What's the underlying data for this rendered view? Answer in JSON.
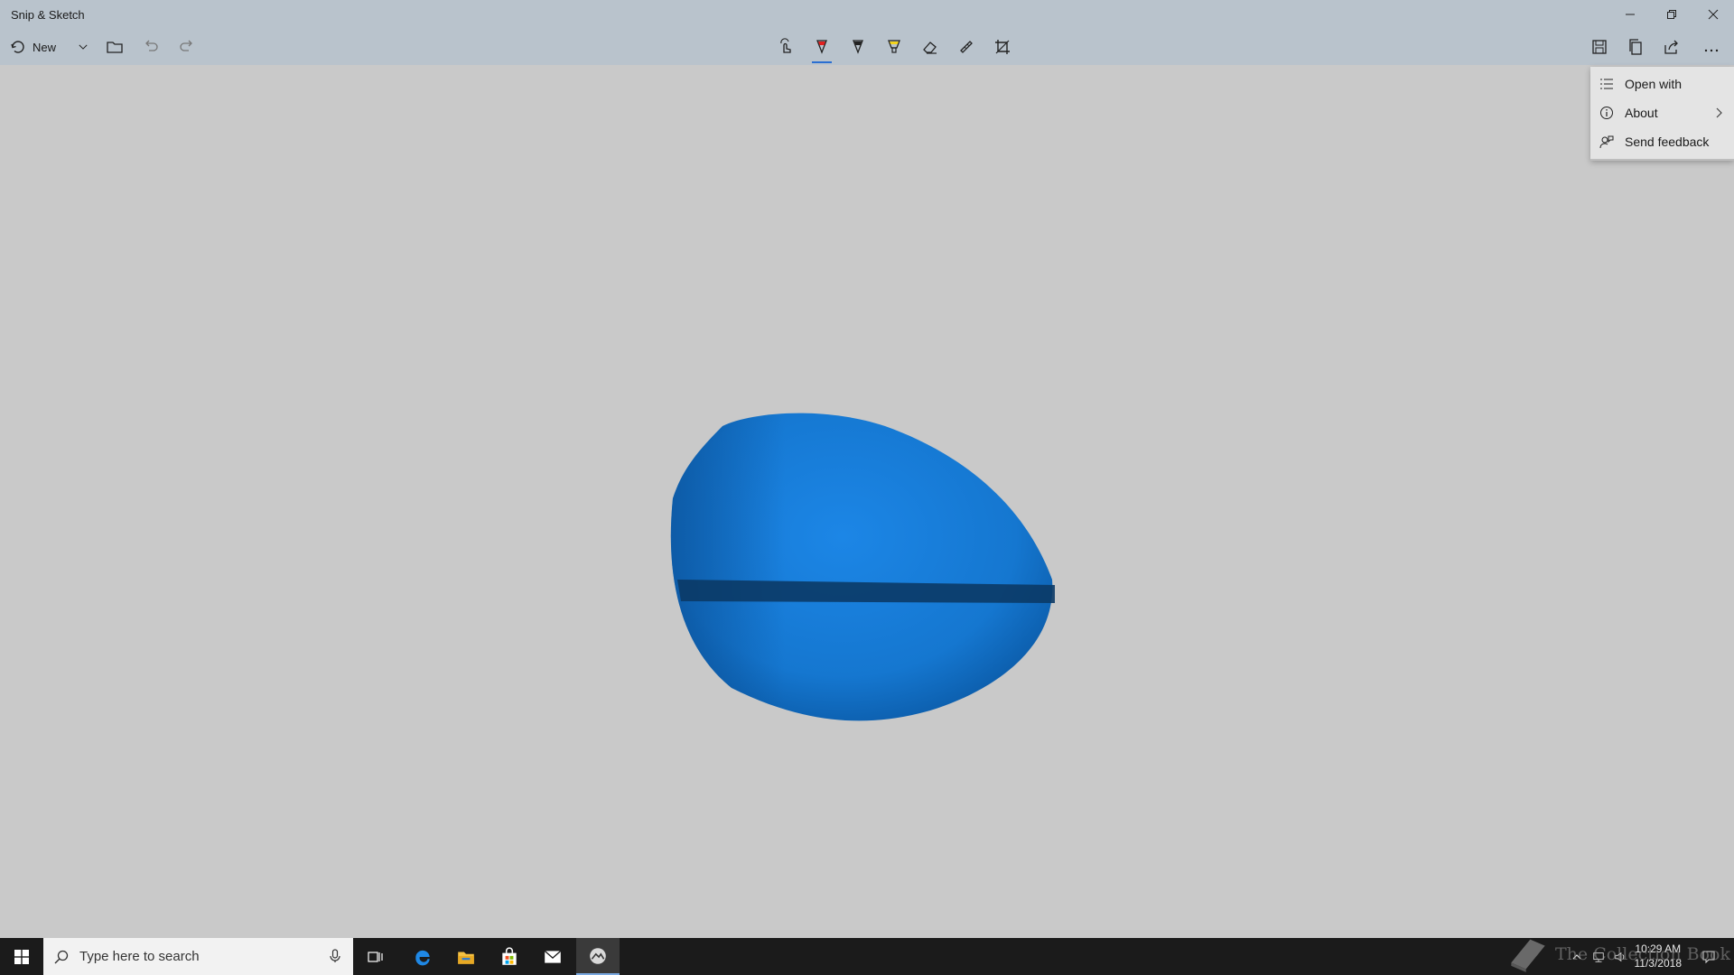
{
  "window": {
    "title": "Snip & Sketch"
  },
  "toolbar": {
    "new_label": "New",
    "accent_color": "#2b6fd1"
  },
  "menu": {
    "items": [
      {
        "label": "Open with",
        "icon": "open-with-icon"
      },
      {
        "label": "About",
        "icon": "info-icon",
        "has_submenu": true
      },
      {
        "label": "Send feedback",
        "icon": "feedback-icon"
      }
    ]
  },
  "taskbar": {
    "search_placeholder": "Type here to search",
    "time": "10:29 AM",
    "date": "11/3/2018",
    "watermark": "The Collection Book"
  },
  "colors": {
    "blob": "#1a7ad6",
    "blob_stripe": "#0b3a66"
  }
}
